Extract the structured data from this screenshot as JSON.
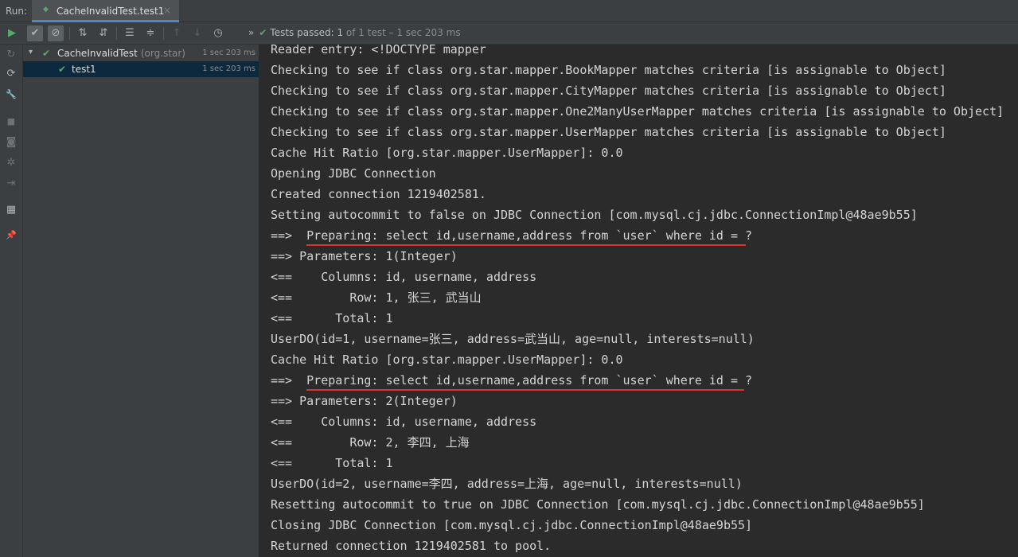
{
  "tabbar": {
    "run_label": "Run:",
    "tab_title": "CacheInvalidTest.test1",
    "tab_close": "×"
  },
  "toolbar": {
    "buttons": [
      {
        "name": "rerun-icon",
        "glyph": "▶"
      },
      {
        "name": "show-passed-icon",
        "glyph": "✔"
      },
      {
        "name": "show-ignored-icon",
        "glyph": "⊘"
      },
      {
        "name": "sort-alpha-icon",
        "glyph": "⇅"
      },
      {
        "name": "sort-duration-icon",
        "glyph": "⇵"
      },
      {
        "name": "expand-all-icon",
        "glyph": "☰"
      },
      {
        "name": "collapse-all-icon",
        "glyph": "≑"
      },
      {
        "name": "prev-failed-icon",
        "glyph": "↑"
      },
      {
        "name": "next-failed-icon",
        "glyph": "↓"
      },
      {
        "name": "history-icon",
        "glyph": "◷"
      }
    ],
    "status": {
      "chevron": "»",
      "check": "✔",
      "passed": "Tests passed:",
      "count": "1",
      "rest": "of 1 test – 1 sec 203 ms"
    }
  },
  "sidebar": {
    "icons": [
      {
        "name": "rerun-failed-icon",
        "glyph": "↻"
      },
      {
        "name": "toggle-autotest-icon",
        "glyph": "⟳"
      },
      {
        "name": "wrench-icon",
        "glyph": "🔧"
      },
      {
        "name": "stop-icon",
        "glyph": "■"
      },
      {
        "name": "camera-icon",
        "glyph": "◙"
      },
      {
        "name": "debug-icon",
        "glyph": "✲"
      },
      {
        "name": "exit-icon",
        "glyph": "⇥"
      },
      {
        "name": "layout-icon",
        "glyph": "▦"
      },
      {
        "name": "pin-icon",
        "glyph": "📌"
      }
    ]
  },
  "tree": {
    "root": {
      "arrow": "▾",
      "check": "✔",
      "name": "CacheInvalidTest",
      "pkg": "(org.star)",
      "time": "1 sec 203 ms"
    },
    "child": {
      "check": "✔",
      "name": "test1",
      "time": "1 sec 203 ms"
    }
  },
  "console": {
    "lines": [
      "Reader entry: <!DOCTYPE mapper",
      "Checking to see if class org.star.mapper.BookMapper matches criteria [is assignable to Object]",
      "Checking to see if class org.star.mapper.CityMapper matches criteria [is assignable to Object]",
      "Checking to see if class org.star.mapper.One2ManyUserMapper matches criteria [is assignable to Object]",
      "Checking to see if class org.star.mapper.UserMapper matches criteria [is assignable to Object]",
      "Cache Hit Ratio [org.star.mapper.UserMapper]: 0.0",
      "Opening JDBC Connection",
      "Created connection 1219402581.",
      "Setting autocommit to false on JDBC Connection [com.mysql.cj.jdbc.ConnectionImpl@48ae9b55]",
      "==>  Preparing: select id,username,address from `user` where id = ?",
      "==> Parameters: 1(Integer)",
      "<==    Columns: id, username, address",
      "<==        Row: 1, 张三, 武当山",
      "<==      Total: 1",
      "UserDO(id=1, username=张三, address=武当山, age=null, interests=null)",
      "Cache Hit Ratio [org.star.mapper.UserMapper]: 0.0",
      "==>  Preparing: select id,username,address from `user` where id = ?",
      "==> Parameters: 2(Integer)",
      "<==    Columns: id, username, address",
      "<==        Row: 2, 李四, 上海",
      "<==      Total: 1",
      "UserDO(id=2, username=李四, address=上海, age=null, interests=null)",
      "Resetting autocommit to true on JDBC Connection [com.mysql.cj.jdbc.ConnectionImpl@48ae9b55]",
      "Closing JDBC Connection [com.mysql.cj.jdbc.ConnectionImpl@48ae9b55]",
      "Returned connection 1219402581 to pool."
    ],
    "highlight_color": "#e03131"
  }
}
